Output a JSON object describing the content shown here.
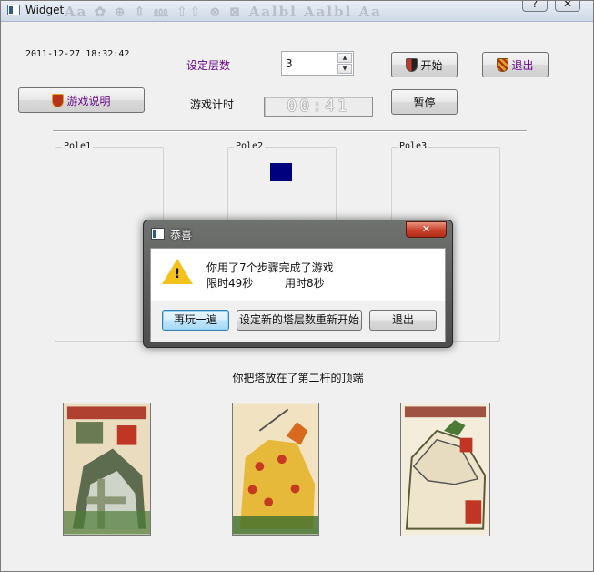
{
  "window": {
    "title": "Widget",
    "help_symbol": "?",
    "close_symbol": "✕",
    "ghost_text": "Aa  ✿  ⊕  ⇕  ⅏  ⇧⇧  ⊗  ⊠  Aalbl  Aalbl  Aa"
  },
  "header": {
    "datetime": "2011-12-27 18:32:42",
    "levels_label": "设定层数",
    "levels_value": "3",
    "timer_label": "游戏计时",
    "timer_value": "00:41",
    "start_label": "开始",
    "exit_label": "退出",
    "help_label": "游戏说明",
    "pause_label": "暂停"
  },
  "poles": [
    {
      "label": "Pole1"
    },
    {
      "label": "Pole2"
    },
    {
      "label": "Pole3"
    }
  ],
  "status": "你把塔放在了第二杆的顶端",
  "dialog": {
    "title": "恭喜",
    "close_symbol": "✕",
    "line1": "你用了7个步骤完成了游戏",
    "line2a": "限时49秒",
    "line2b": "用时8秒",
    "btn_replay": "再玩一遍",
    "btn_newlevel": "设定新的塔层数重新开始",
    "btn_exit": "退出"
  },
  "colors": {
    "disk_small": "#00007f",
    "disk_medium": "#2e8b2e",
    "label_purple": "#6a0a8a"
  }
}
